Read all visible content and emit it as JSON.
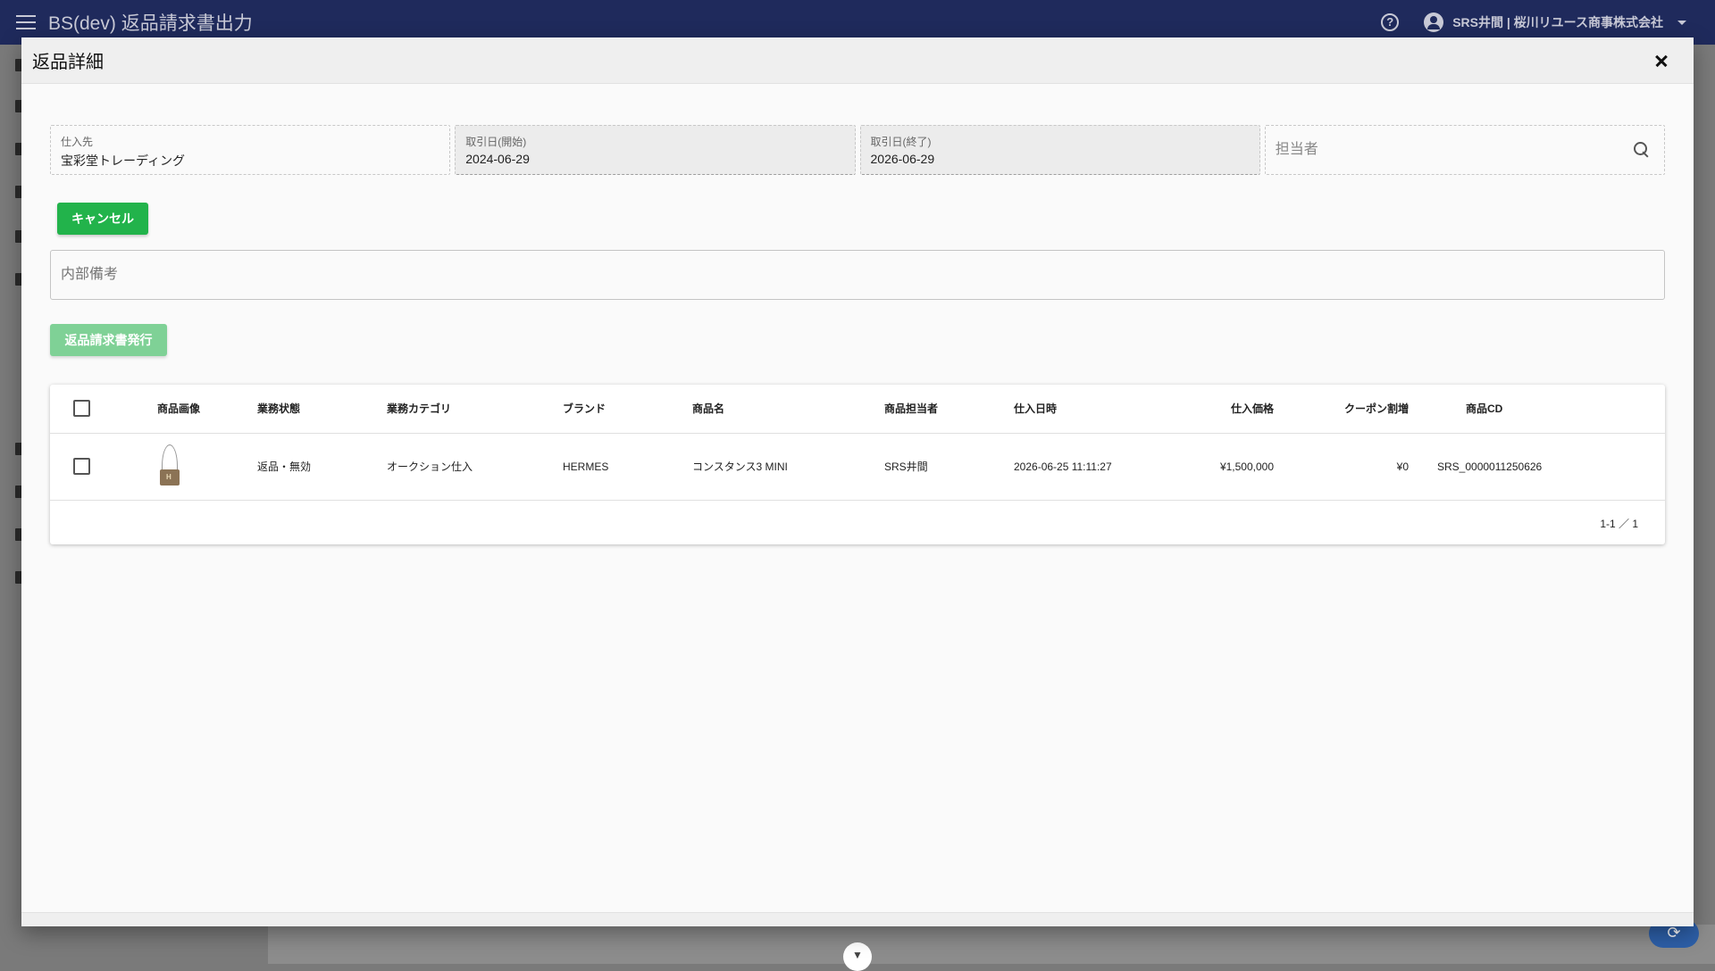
{
  "appbar": {
    "title": "BS(dev) 返品請求書出力",
    "user": "SRS井間 | 桜川リユース商事株式会社"
  },
  "dialog": {
    "title": "返品詳細",
    "fields": {
      "supplier": {
        "label": "仕入先",
        "value": "宝彩堂トレーディング"
      },
      "date_start": {
        "label": "取引日(開始)",
        "value": "2024-06-29"
      },
      "date_end": {
        "label": "取引日(終了)",
        "value": "2026-06-29"
      },
      "staff": {
        "placeholder": "担当者"
      }
    },
    "cancel_label": "キャンセル",
    "memo_placeholder": "内部備考",
    "issue_label": "返品請求書発行",
    "table": {
      "headers": {
        "image": "商品画像",
        "status": "業務状態",
        "category": "業務カテゴリ",
        "brand": "ブランド",
        "name": "商品名",
        "owner": "商品担当者",
        "datetime": "仕入日時",
        "price": "仕入価格",
        "coupon": "クーポン割増",
        "code": "商品CD"
      },
      "rows": [
        {
          "status": "返品・無効",
          "category": "オークション仕入",
          "brand": "HERMES",
          "name": "コンスタンス3 MINI",
          "owner": "SRS井間",
          "datetime": "2026-06-25 11:11:27",
          "price": "¥1,500,000",
          "coupon": "¥0",
          "code": "SRS_0000011250626"
        }
      ],
      "pagination": "1-1 ／ 1"
    }
  },
  "colors": {
    "appbar": "#1f2a5c",
    "cancel_button": "#22b34b",
    "issue_button_disabled": "#7fd196"
  }
}
